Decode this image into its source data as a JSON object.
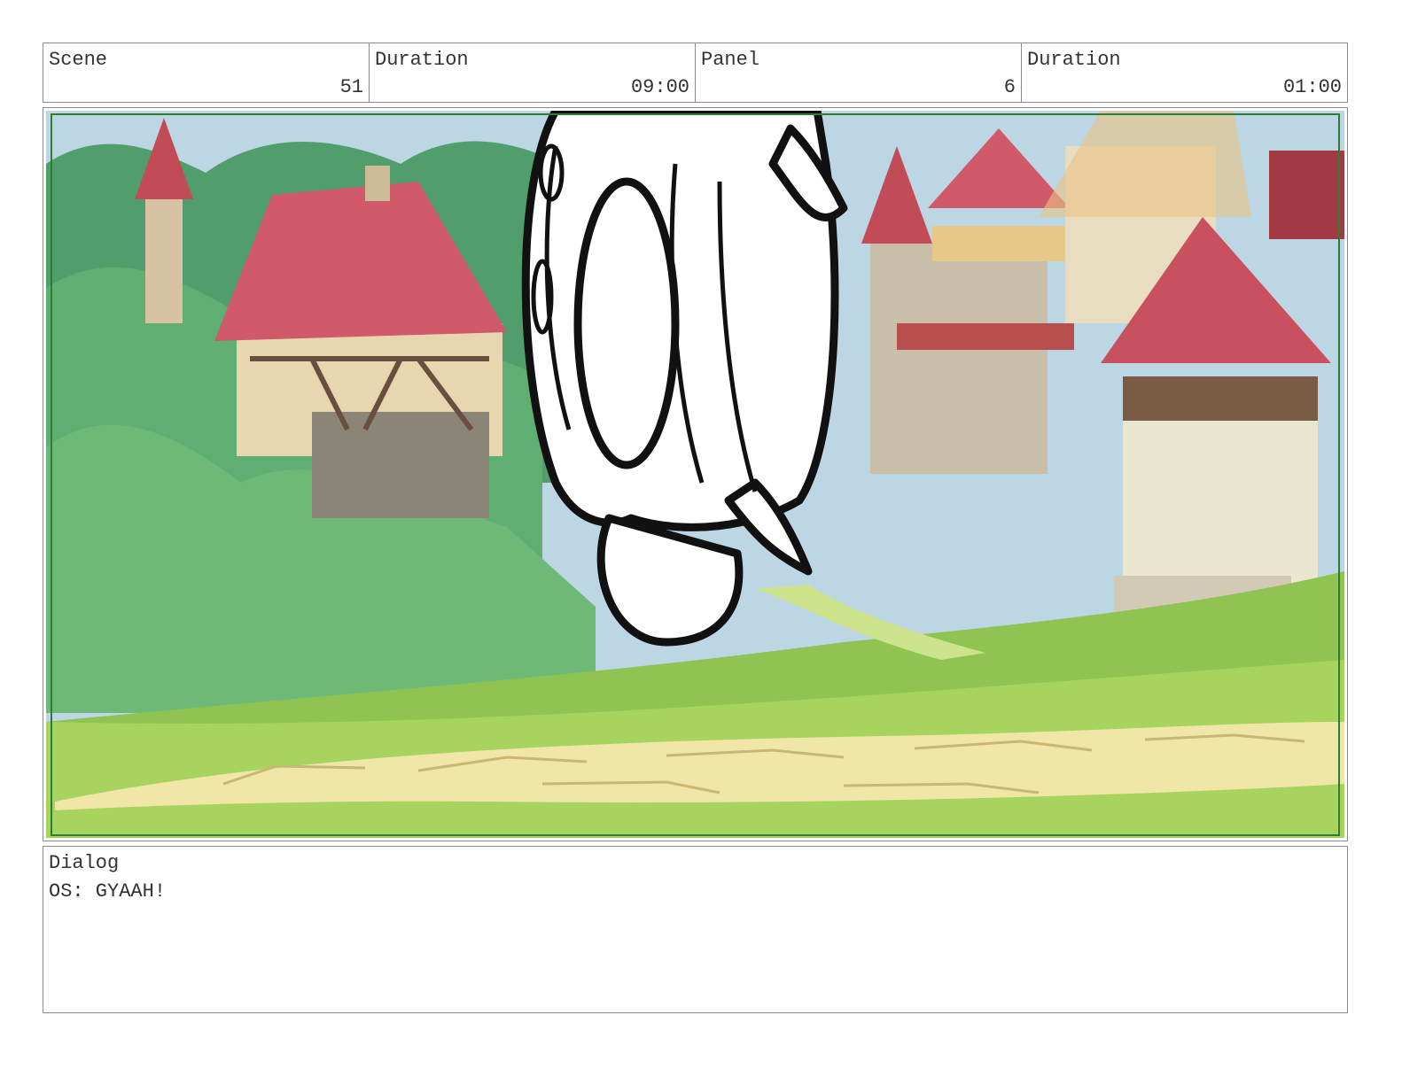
{
  "header": {
    "scene_label": "Scene",
    "scene_value": "51",
    "duration_label": "Duration",
    "duration_value": "09:00",
    "panel_label": "Panel",
    "panel_value": "6",
    "panel_duration_label": "Duration",
    "panel_duration_value": "01:00"
  },
  "panel_image": {
    "content": "storyboard-frame",
    "colors": {
      "sky": "#bcd6e4",
      "grass": "#9ccc55",
      "path": "#f0e6a8",
      "roof": "#c9505e",
      "frame": "#2e7d32"
    }
  },
  "dialog": {
    "label": "Dialog",
    "text": "OS: GYAAH!"
  }
}
